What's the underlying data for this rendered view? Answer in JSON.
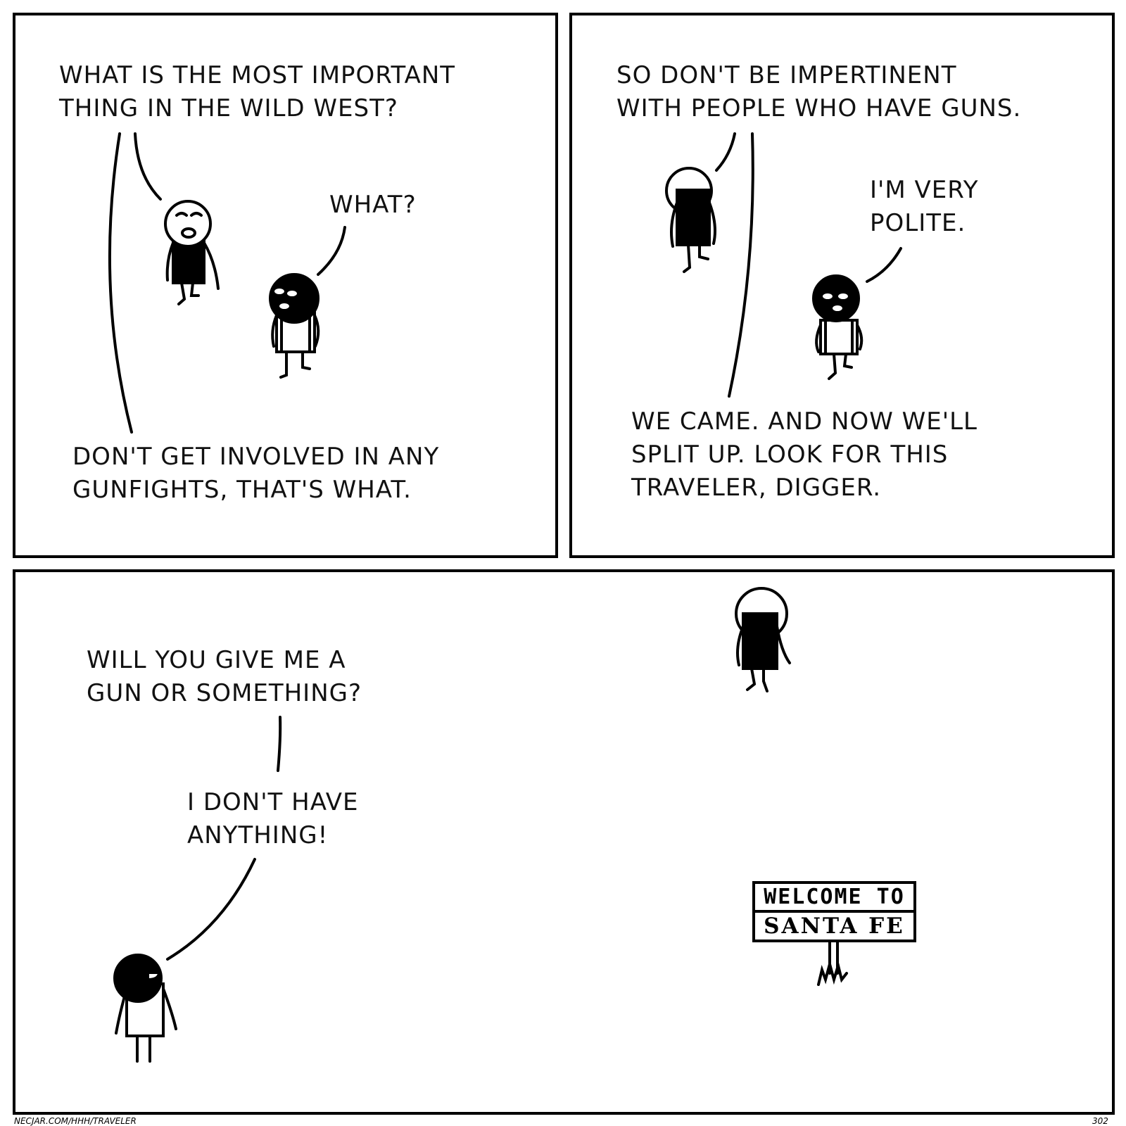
{
  "panel1": {
    "caption_top": [
      "What is the most important",
      "thing in the Wild West?"
    ],
    "speech_what": [
      "What?"
    ],
    "caption_bottom": [
      "Don't get involved in any",
      "gunfights, that's what."
    ]
  },
  "panel2": {
    "caption_top": [
      "So don't be impertinent",
      "with people who have guns."
    ],
    "speech_polite": [
      "I'm very",
      "polite."
    ],
    "caption_bottom": [
      "We came. And now we'll",
      "split up. Look for this",
      "traveler, Digger."
    ]
  },
  "panel3": {
    "speech_gun": [
      "Will you give me a",
      "gun or something?"
    ],
    "speech_nothing": [
      "I don't have",
      "anything!"
    ],
    "sign": {
      "line1": "WELCOME TO",
      "line2": "SANTA FE"
    }
  },
  "footer": {
    "credit": "NECJAR.COM/HHH/TRAVELER",
    "page_number": "302"
  },
  "colors": {
    "ink": "#000000",
    "paper": "#ffffff"
  }
}
